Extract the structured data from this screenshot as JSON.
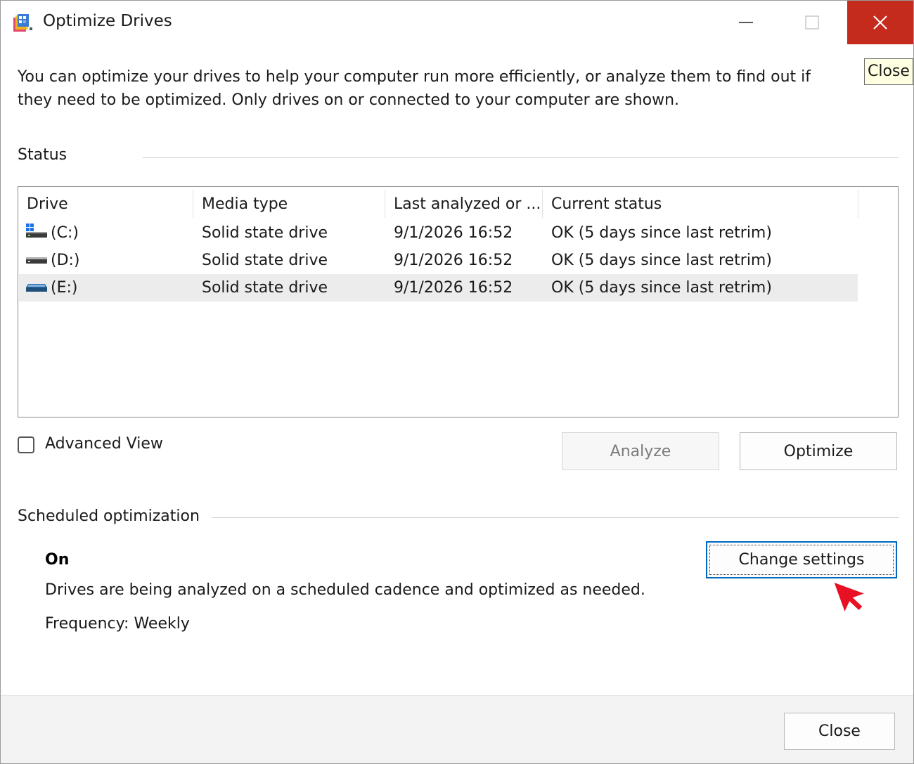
{
  "window": {
    "title": "Optimize Drives",
    "close_tooltip": "Close"
  },
  "description": "You can optimize your drives to help your computer run more efficiently, or analyze them to find out if they need to be optimized. Only drives on or connected to your computer are shown.",
  "status": {
    "label": "Status",
    "columns": [
      "Drive",
      "Media type",
      "Last analyzed or ...",
      "Current status"
    ],
    "rows": [
      {
        "drive": "(C:)",
        "media_type": "Solid state drive",
        "last_analyzed": "9/1/2026 16:52",
        "status": "OK (5 days since last retrim)",
        "icon": "system-drive-icon",
        "selected": false
      },
      {
        "drive": "(D:)",
        "media_type": "Solid state drive",
        "last_analyzed": "9/1/2026 16:52",
        "status": "OK (5 days since last retrim)",
        "icon": "drive-icon",
        "selected": false
      },
      {
        "drive": "(E:)",
        "media_type": "Solid state drive",
        "last_analyzed": "9/1/2026 16:52",
        "status": "OK (5 days since last retrim)",
        "icon": "removable-drive-icon",
        "selected": true
      }
    ]
  },
  "controls": {
    "advanced_view_label": "Advanced View",
    "advanced_view_checked": false,
    "analyze_label": "Analyze",
    "optimize_label": "Optimize"
  },
  "scheduled": {
    "label": "Scheduled optimization",
    "state": "On",
    "description": "Drives are being analyzed on a scheduled cadence and optimized as needed.",
    "frequency": "Frequency: Weekly",
    "change_settings_label": "Change settings"
  },
  "footer": {
    "close_label": "Close"
  },
  "colors": {
    "close_button_bg": "#c42b1c",
    "selection_bg": "#ececec",
    "focus_border": "#0067c0",
    "cursor": "#e81123"
  }
}
